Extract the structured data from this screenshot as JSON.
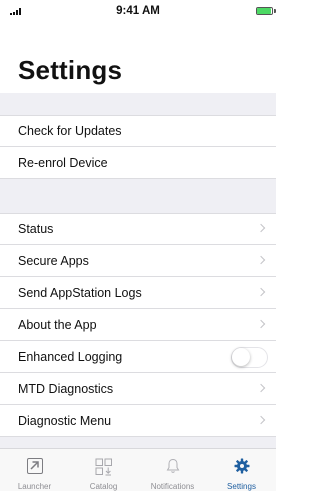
{
  "status_bar": {
    "time": "9:41 AM"
  },
  "page": {
    "title": "Settings"
  },
  "group1": [
    {
      "label": "Check for Updates"
    },
    {
      "label": "Re-enrol Device"
    }
  ],
  "group2": [
    {
      "label": "Status",
      "accessory": "chevron"
    },
    {
      "label": "Secure Apps",
      "accessory": "chevron"
    },
    {
      "label": "Send AppStation Logs",
      "accessory": "chevron"
    },
    {
      "label": "About the App",
      "accessory": "chevron"
    },
    {
      "label": "Enhanced Logging",
      "accessory": "toggle",
      "toggle_on": false
    },
    {
      "label": "MTD Diagnostics",
      "accessory": "chevron"
    },
    {
      "label": "Diagnostic Menu",
      "accessory": "chevron"
    }
  ],
  "tab_bar": {
    "active": "Settings",
    "tabs": [
      {
        "label": "Launcher",
        "icon": "launcher-icon"
      },
      {
        "label": "Catalog",
        "icon": "catalog-icon"
      },
      {
        "label": "Notifications",
        "icon": "bell-icon"
      },
      {
        "label": "Settings",
        "icon": "gear-icon"
      }
    ]
  },
  "colors": {
    "accent": "#1f5fa0",
    "section_background": "#efeff4",
    "battery": "#4cd964"
  }
}
